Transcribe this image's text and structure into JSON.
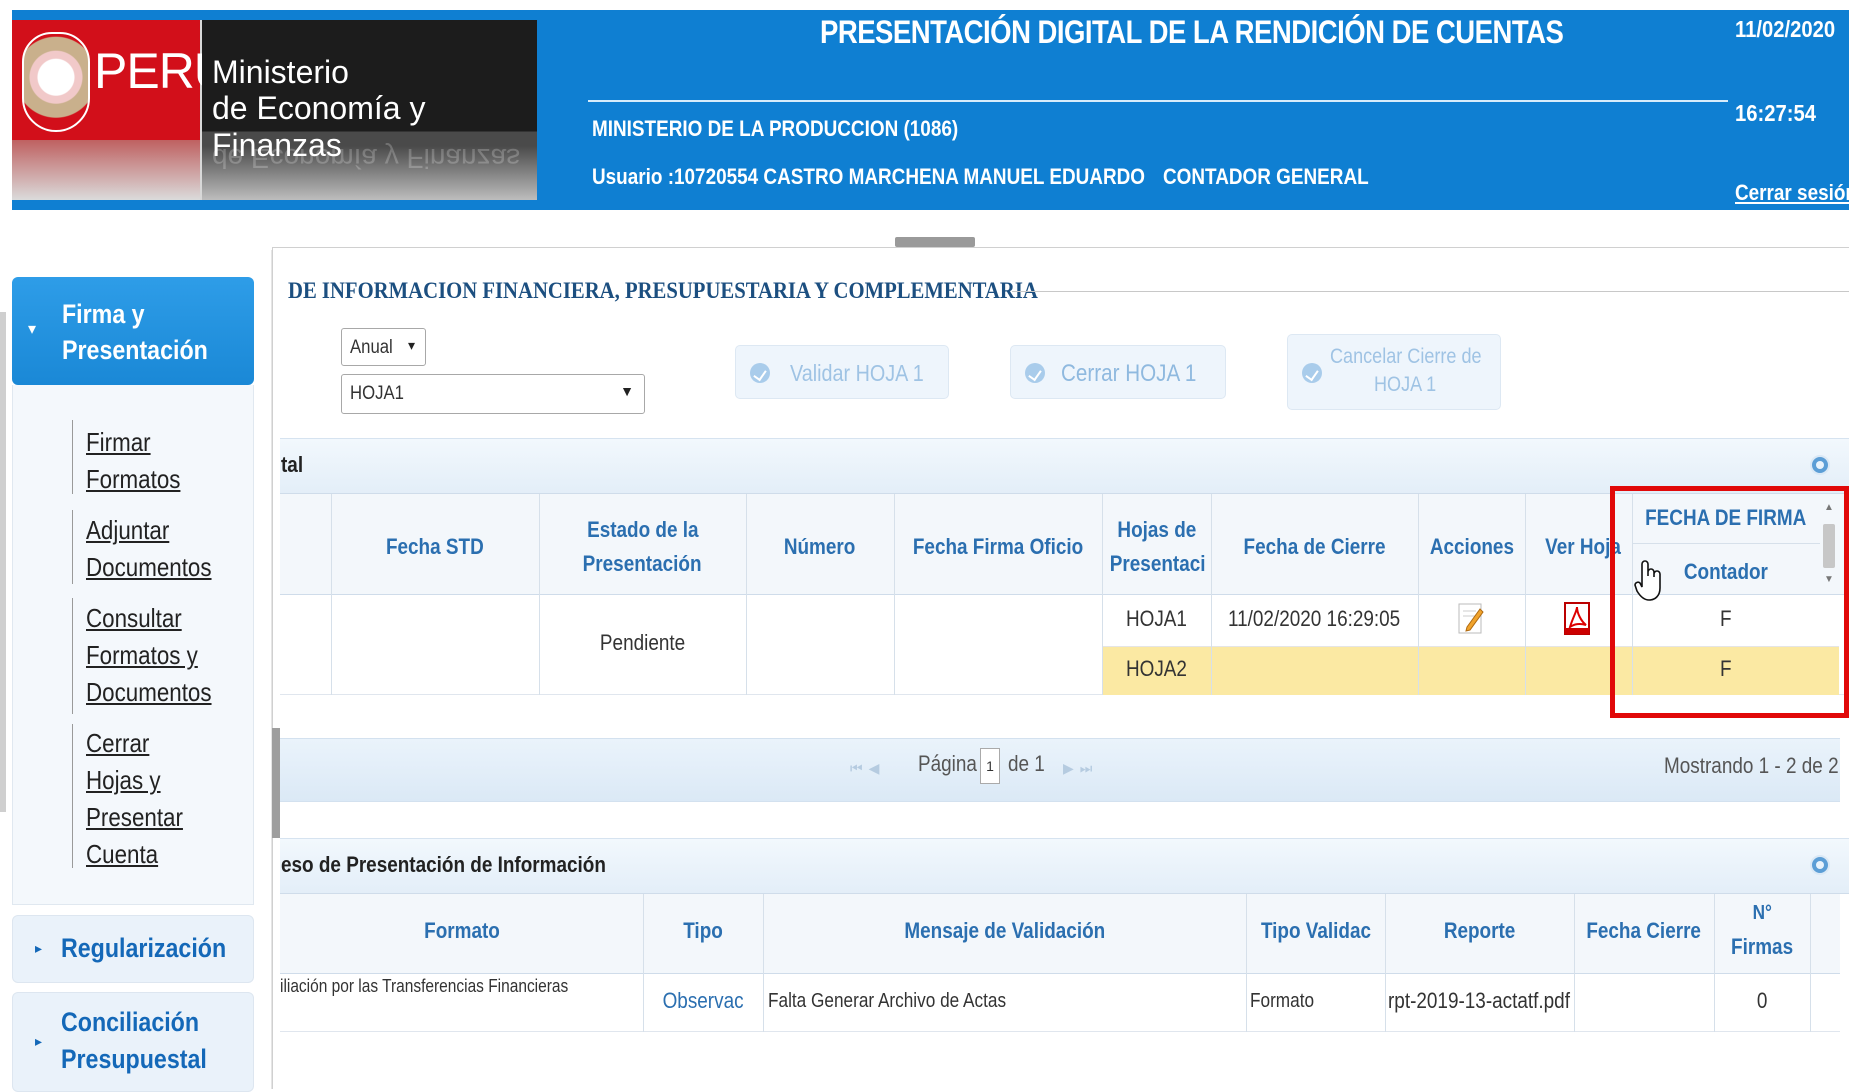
{
  "header": {
    "logo": {
      "country": "PERÚ",
      "line1": "Ministerio",
      "line2": "de Economía y Finanzas"
    },
    "title": "PRESENTACIÓN DIGITAL DE LA RENDICIÓN DE CUENTAS",
    "entity": "MINISTERIO DE LA PRODUCCION (1086)",
    "user": "Usuario :10720554 CASTRO MARCHENA MANUEL EDUARDO",
    "role": "CONTADOR GENERAL",
    "date": "11/02/2020",
    "time": "16:27:54",
    "logout": "Cerrar sesión"
  },
  "sidebar": {
    "firma": {
      "line1": "Firma y",
      "line2": "Presentación"
    },
    "links": [
      {
        "lines": [
          "Firmar",
          "Formatos"
        ]
      },
      {
        "lines": [
          "Adjuntar",
          "Documentos"
        ]
      },
      {
        "lines": [
          "Consultar",
          "Formatos y",
          "Documentos"
        ]
      },
      {
        "lines": [
          "Cerrar",
          "Hojas y",
          "Presentar",
          "Cuenta"
        ]
      }
    ],
    "regularizacion": "Regularización",
    "conciliacion": {
      "line1": "Conciliación",
      "line2": "Presupuestal"
    }
  },
  "main": {
    "section_title": "DE INFORMACION FINANCIERA, PRESUPUESTARIA Y COMPLEMENTARIA",
    "period_select": "Anual",
    "sheet_select": "HOJA1",
    "btn_validar": "Validar HOJA 1",
    "btn_cerrar": "Cerrar HOJA 1",
    "btn_cancelar": {
      "line1": "Cancelar Cierre de",
      "line2": "HOJA 1"
    }
  },
  "grid1": {
    "title": "tal",
    "headers": {
      "fecha_std": "Fecha STD",
      "estado": {
        "line1": "Estado de la",
        "line2": "Presentación"
      },
      "numero": "Número",
      "fecha_firma": "Fecha Firma Oficio",
      "hojas": {
        "line1": "Hojas de",
        "line2": "Presentaci"
      },
      "fecha_cierre": "Fecha de Cierre",
      "acciones": "Acciones",
      "ver_hoja": "Ver Hoja",
      "fecha_de_firma": "FECHA DE FIRMA",
      "contador": "Contador"
    },
    "estado_value": "Pendiente",
    "rows": [
      {
        "hoja": "HOJA1",
        "fecha_cierre": "11/02/2020 16:29:05",
        "contador": "F"
      },
      {
        "hoja": "HOJA2",
        "fecha_cierre": "",
        "contador": "F"
      }
    ],
    "pager": {
      "page_label": "Página",
      "page": "1",
      "of_label": "de 1",
      "info": "Mostrando 1 - 2 de 2"
    }
  },
  "grid2": {
    "title": "eso de Presentación de Información",
    "headers": {
      "formato": "Formato",
      "tipo": "Tipo",
      "mensaje": "Mensaje de Validación",
      "tipo_validac": "Tipo Validac",
      "reporte": "Reporte",
      "fecha_cierre": "Fecha Cierre",
      "nfirmas": {
        "line1": "N°",
        "line2": "Firmas"
      }
    },
    "row": {
      "formato": "iliación por las Transferencias Financieras",
      "tipo": "Observac",
      "mensaje": "Falta Generar Archivo de Actas",
      "tipo_validac": "Formato",
      "reporte": "rpt-2019-13-actatf.pdf",
      "nfirmas": "0"
    }
  },
  "colors": {
    "header_blue": "#0f7fd2",
    "highlight_red": "#e10909",
    "row_highlight": "#fbe9a3",
    "link_blue": "#2b6fb0"
  }
}
